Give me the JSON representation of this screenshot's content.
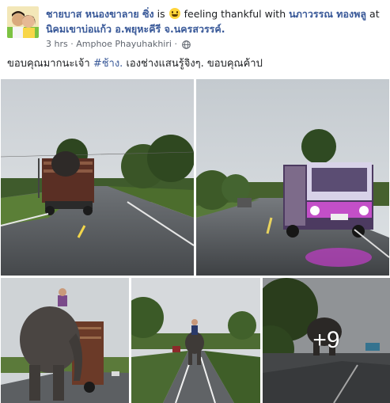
{
  "post": {
    "author": "ชายบาส หนองขาลาย ซิ่ง",
    "is_text": "is",
    "feeling_icon": "smiling-face-emoji",
    "feeling_text": "feeling thankful with",
    "tagged_person": "นภาวรรณ ทองพลู",
    "at_text": "at",
    "location": "นิคมเขาบ่อแก้ว อ.พยุหะคีรี จ.นครสวรรค์.",
    "timestamp": "3 hrs",
    "separator": "·",
    "place": "Amphoe Phayuhakhiri",
    "privacy_icon": "globe-icon",
    "message_before": "ขอบคุณมากนะเจ้า ",
    "hashtag": "#ช้าง.",
    "message_after": " เองช่างแสนรู้จิงๆ. ขอบคุณค้าป"
  },
  "photos": {
    "more_count": "+9"
  },
  "colors": {
    "link": "#385898",
    "text": "#1c1e21",
    "meta": "#616770"
  }
}
